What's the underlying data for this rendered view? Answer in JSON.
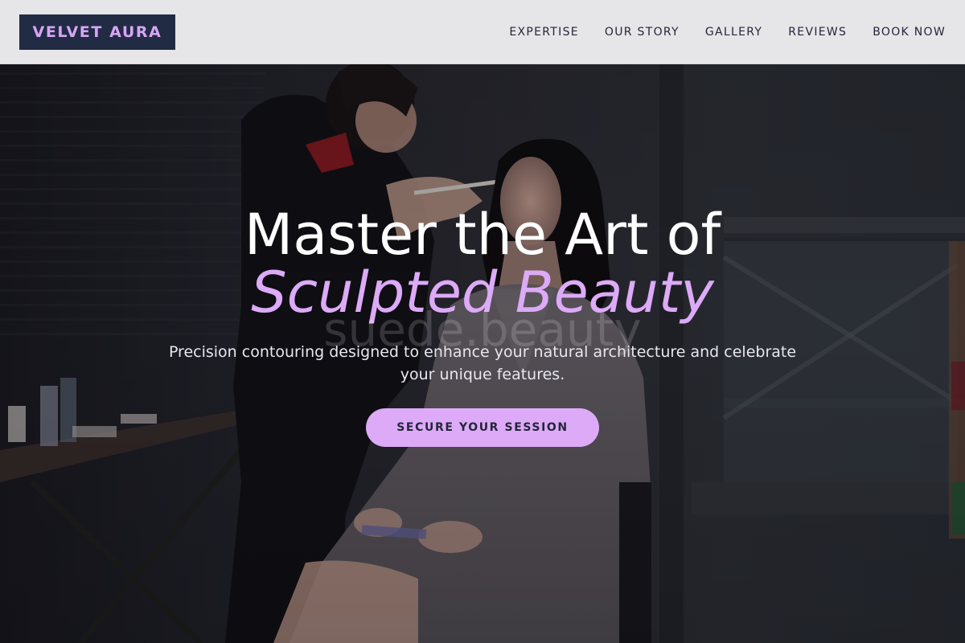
{
  "brand": {
    "logo_text": "VELVET AURA"
  },
  "nav": {
    "items": [
      {
        "label": "EXPERTISE"
      },
      {
        "label": "OUR STORY"
      },
      {
        "label": "GALLERY"
      },
      {
        "label": "REVIEWS"
      },
      {
        "label": "BOOK NOW"
      }
    ]
  },
  "hero": {
    "headline": "Master the Art of",
    "headline_accent": "Sculpted Beauty",
    "watermark": "suede.beauty",
    "subtitle": "Precision contouring designed to enhance your natural architecture and celebrate your unique features.",
    "cta_label": "SECURE YOUR SESSION",
    "image_description": "Makeup artist applying makeup with a brush to a seated woman in a grey coat, backstage setting"
  },
  "colors": {
    "accent": "#dcaaf7",
    "logo_bg": "#222b44",
    "navbar_bg": "#e6e6e8",
    "nav_text": "#24263a"
  }
}
